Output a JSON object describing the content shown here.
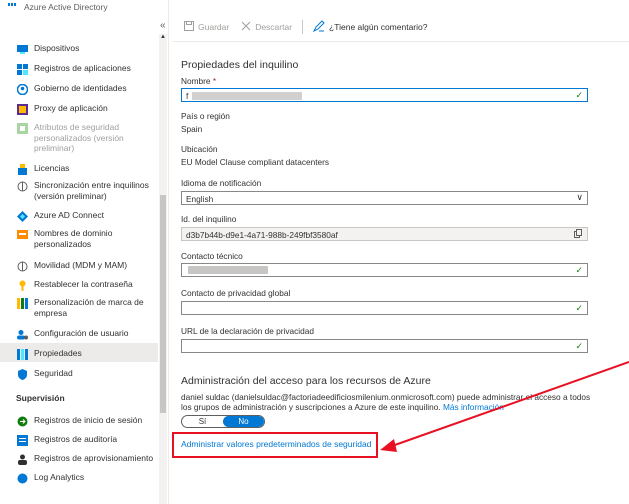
{
  "app": {
    "brand": "Azure Active Directory",
    "collapse_glyph": "«"
  },
  "toolbar": {
    "save": "Guardar",
    "discard": "Descartar",
    "feedback": "¿Tiene algún comentario?"
  },
  "sidebar": {
    "items": [
      {
        "label": "Dispositivos",
        "icon": "devices-icon"
      },
      {
        "label": "Registros de aplicaciones",
        "icon": "app-registrations-icon"
      },
      {
        "label": "Gobierno de identidades",
        "icon": "identity-governance-icon"
      },
      {
        "label": "Proxy de aplicación",
        "icon": "application-proxy-icon"
      },
      {
        "label": "Atributos de seguridad personalizados (versión preliminar)",
        "icon": "custom-security-attributes-icon",
        "disabled": true
      },
      {
        "label": "Licencias",
        "icon": "licenses-icon"
      },
      {
        "label": "Sincronización entre inquilinos (versión preliminar)",
        "icon": "cross-tenant-sync-icon"
      },
      {
        "label": "Azure AD Connect",
        "icon": "ad-connect-icon"
      },
      {
        "label": "Nombres de dominio personalizados",
        "icon": "custom-domain-icon"
      },
      {
        "label": "Movilidad (MDM y MAM)",
        "icon": "mobility-icon"
      },
      {
        "label": "Restablecer la contraseña",
        "icon": "password-reset-icon"
      },
      {
        "label": "Personalización de marca de empresa",
        "icon": "company-branding-icon"
      },
      {
        "label": "Configuración de usuario",
        "icon": "user-settings-icon"
      },
      {
        "label": "Propiedades",
        "icon": "properties-icon",
        "active": true
      },
      {
        "label": "Seguridad",
        "icon": "security-shield-icon"
      }
    ],
    "section_monitoring": "Supervisión",
    "monitoring_items": [
      {
        "label": "Registros de inicio de sesión",
        "icon": "sign-in-logs-icon"
      },
      {
        "label": "Registros de auditoría",
        "icon": "audit-logs-icon"
      },
      {
        "label": "Registros de aprovisionamiento",
        "icon": "provisioning-logs-icon"
      },
      {
        "label": "Log Analytics",
        "icon": "log-analytics-icon"
      }
    ]
  },
  "main": {
    "section_title": "Propiedades del inquilino",
    "name_label": "Nombre",
    "name_required_mark": "*",
    "name_value": "f",
    "country_label": "País o región",
    "country_value": "Spain",
    "location_label": "Ubicación",
    "location_value": "EU Model Clause compliant datacenters",
    "notif_lang_label": "Idioma de notificación",
    "notif_lang_value": "English",
    "tenant_id_label": "Id. del inquilino",
    "tenant_id_value": "d3b7b44b-d9e1-4a71-988b-249fbf3580af",
    "tech_contact_label": "Contacto técnico",
    "privacy_contact_label": "Contacto de privacidad global",
    "privacy_url_label": "URL de la declaración de privacidad",
    "access_title": "Administración del acceso para los recursos de Azure",
    "access_desc": "daniel suldac (danielsuldac@factoriadeedificiosmilenium.onmicrosoft.com) puede administrar el acceso a todos los grupos de administración y suscripciones a Azure de este inquilino.",
    "more_info": "Más información",
    "toggle_yes": "Sí",
    "toggle_no": "No",
    "security_defaults_link": "Administrar valores predeterminados de seguridad"
  },
  "colors": {
    "accent": "#0078d4",
    "highlight_red": "#e81123",
    "valid_green": "#107c10"
  },
  "chevron_glyph": "∨",
  "check_glyph": "✓"
}
